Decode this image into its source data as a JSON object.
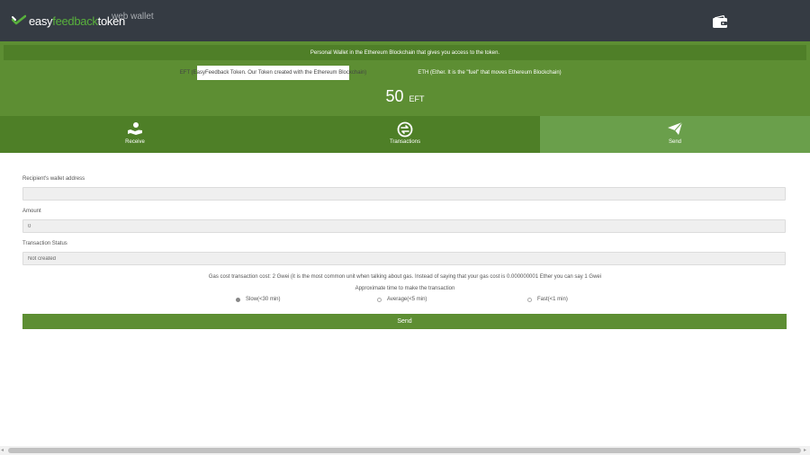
{
  "header": {
    "brand_part1": "easy",
    "brand_part2": "feedback",
    "brand_part3": "token",
    "subtitle": "web wallet",
    "wallet_icon": "wallet-icon"
  },
  "hero": {
    "banner": "Personal Wallet in the Ethereum Blockchain that gives you access to the token.",
    "eft_button": "EFT (EasyFeedback Token. Our Token created with the Ethereum Blockchain)",
    "eth_button": "ETH (Ether. It is the \"fuel\" that moves Ethereum Blockchain)",
    "balance_amount": "50",
    "balance_unit": "EFT"
  },
  "tabs": [
    {
      "label": "Receive",
      "icon": "hand-coin-icon"
    },
    {
      "label": "Transactions",
      "icon": "transactions-icon"
    },
    {
      "label": "Send",
      "icon": "paper-plane-icon",
      "active": true
    }
  ],
  "form": {
    "recipient_label": "Recipient's wallet address",
    "recipient_value": "",
    "amount_label": "Amount",
    "amount_value": "0",
    "status_label": "Transaction Status",
    "status_value": "Not created",
    "gas_note": "Gas cost transaction cost: 2 Gwei (it is the most common unit when talking about gas. Instead of saying that your gas cost is 0.000000001 Ether you can say 1 Gwei",
    "time_label": "Approximate time to make the transaction",
    "speed_options": [
      {
        "label": "Slow(<30 min)",
        "checked": true
      },
      {
        "label": "Average(<5 min)",
        "checked": false
      },
      {
        "label": "Fast(<1 min)",
        "checked": false
      }
    ],
    "send_button": "Send"
  },
  "colors": {
    "topbar": "#353b43",
    "green": "#5d8e33",
    "green_dark": "#4e7f27",
    "green_active": "#6a9f4b",
    "brand_green": "#58b03c"
  }
}
